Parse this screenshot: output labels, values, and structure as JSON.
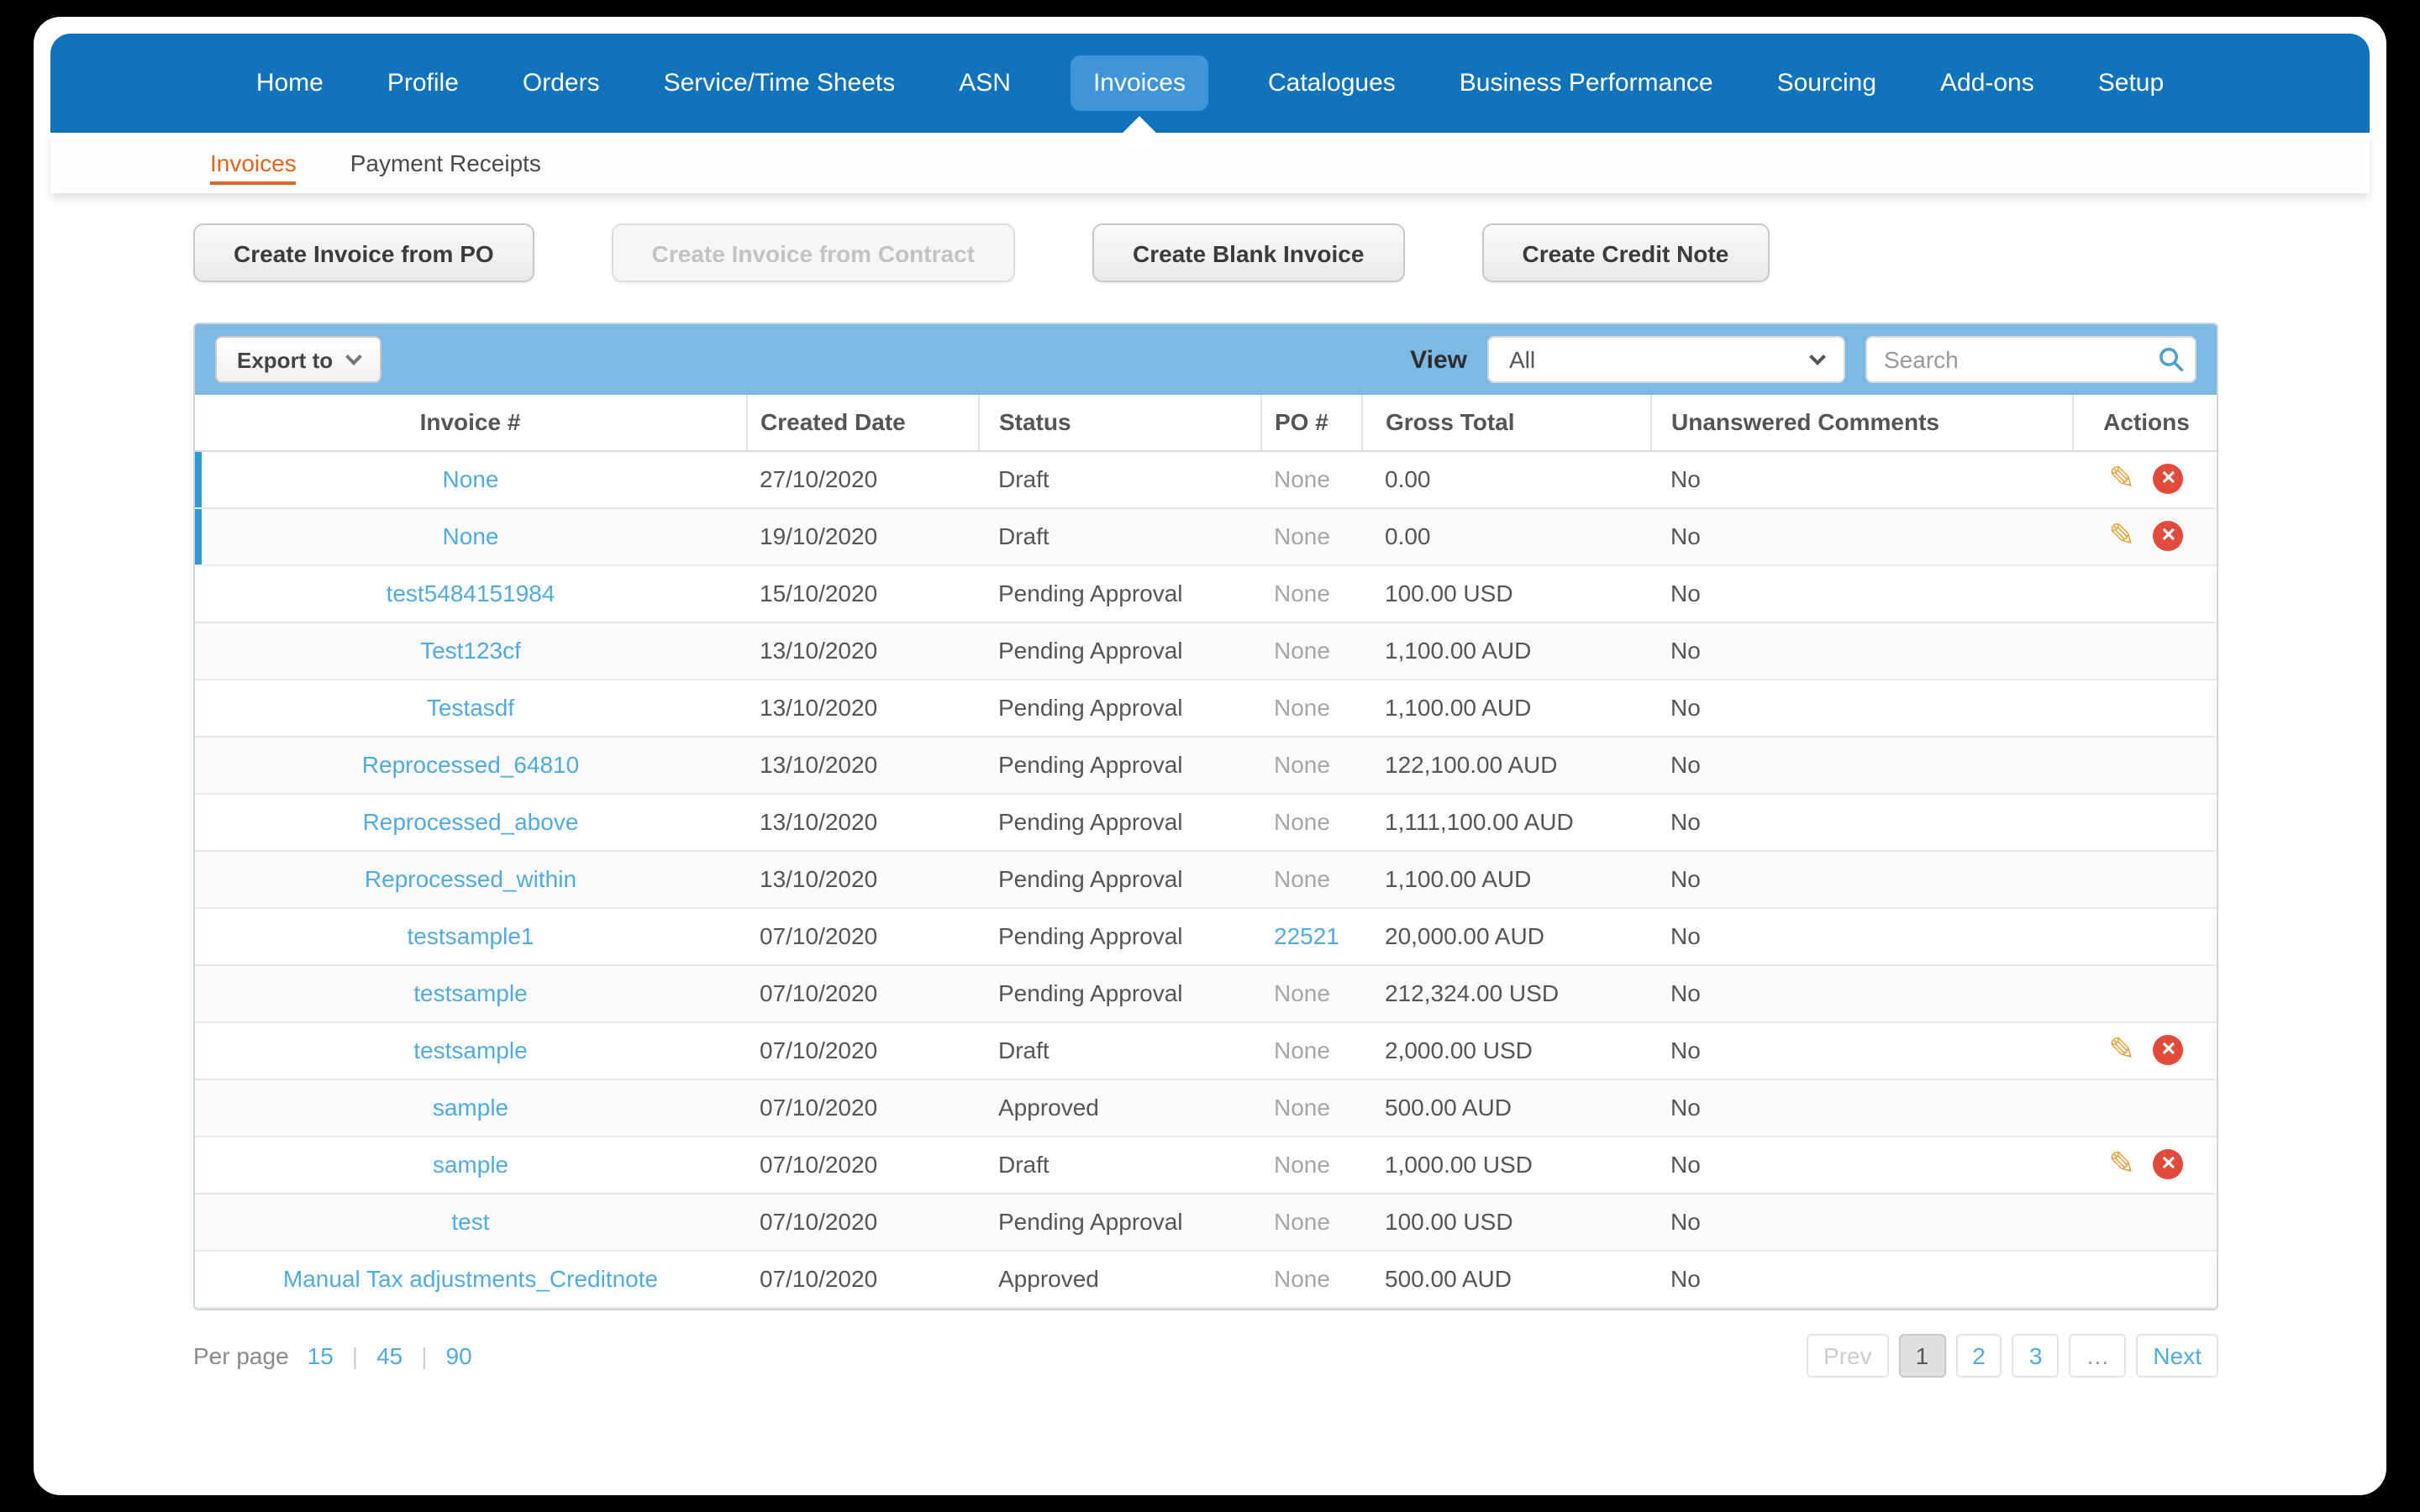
{
  "colors": {
    "nav_blue": "#1173BB",
    "active_tab_blue": "#3F95D8",
    "toolbar_blue": "#7DB9E3",
    "link_blue": "#52ABDF",
    "active_orange": "#E0651E",
    "delete_red": "#E14B3B",
    "pencil_orange": "#E5A33C"
  },
  "icons": {
    "edit_pencil": "✎",
    "delete_x": "✕"
  },
  "nav": {
    "items": [
      {
        "label": "Home",
        "active": false
      },
      {
        "label": "Profile",
        "active": false
      },
      {
        "label": "Orders",
        "active": false
      },
      {
        "label": "Service/Time Sheets",
        "active": false
      },
      {
        "label": "ASN",
        "active": false
      },
      {
        "label": "Invoices",
        "active": true
      },
      {
        "label": "Catalogues",
        "active": false
      },
      {
        "label": "Business Performance",
        "active": false
      },
      {
        "label": "Sourcing",
        "active": false
      },
      {
        "label": "Add-ons",
        "active": false
      },
      {
        "label": "Setup",
        "active": false
      }
    ]
  },
  "subnav": {
    "items": [
      {
        "label": "Invoices",
        "active": true
      },
      {
        "label": "Payment Receipts",
        "active": false
      }
    ]
  },
  "actions_bar": {
    "buttons": [
      {
        "label": "Create Invoice from PO",
        "enabled": true
      },
      {
        "label": "Create Invoice from Contract",
        "enabled": false
      },
      {
        "label": "Create Blank Invoice",
        "enabled": true
      },
      {
        "label": "Create Credit Note",
        "enabled": true
      }
    ]
  },
  "table_toolbar": {
    "export_label": "Export to",
    "view_label": "View",
    "view_value": "All",
    "search_placeholder": "Search"
  },
  "table": {
    "columns": [
      "Invoice #",
      "Created Date",
      "Status",
      "PO #",
      "Gross Total",
      "Unanswered Comments",
      "Actions"
    ],
    "rows": [
      {
        "invoice": "None",
        "created": "27/10/2020",
        "status": "Draft",
        "po": "None",
        "po_is_link": false,
        "gross": "0.00",
        "comments": "No",
        "has_actions": true,
        "selected": true
      },
      {
        "invoice": "None",
        "created": "19/10/2020",
        "status": "Draft",
        "po": "None",
        "po_is_link": false,
        "gross": "0.00",
        "comments": "No",
        "has_actions": true,
        "selected": true
      },
      {
        "invoice": "test5484151984",
        "created": "15/10/2020",
        "status": "Pending Approval",
        "po": "None",
        "po_is_link": false,
        "gross": "100.00 USD",
        "comments": "No",
        "has_actions": false,
        "selected": false
      },
      {
        "invoice": "Test123cf",
        "created": "13/10/2020",
        "status": "Pending Approval",
        "po": "None",
        "po_is_link": false,
        "gross": "1,100.00 AUD",
        "comments": "No",
        "has_actions": false,
        "selected": false
      },
      {
        "invoice": "Testasdf",
        "created": "13/10/2020",
        "status": "Pending Approval",
        "po": "None",
        "po_is_link": false,
        "gross": "1,100.00 AUD",
        "comments": "No",
        "has_actions": false,
        "selected": false
      },
      {
        "invoice": "Reprocessed_64810",
        "created": "13/10/2020",
        "status": "Pending Approval",
        "po": "None",
        "po_is_link": false,
        "gross": "122,100.00 AUD",
        "comments": "No",
        "has_actions": false,
        "selected": false
      },
      {
        "invoice": "Reprocessed_above",
        "created": "13/10/2020",
        "status": "Pending Approval",
        "po": "None",
        "po_is_link": false,
        "gross": "1,111,100.00 AUD",
        "comments": "No",
        "has_actions": false,
        "selected": false
      },
      {
        "invoice": "Reprocessed_within",
        "created": "13/10/2020",
        "status": "Pending Approval",
        "po": "None",
        "po_is_link": false,
        "gross": "1,100.00 AUD",
        "comments": "No",
        "has_actions": false,
        "selected": false
      },
      {
        "invoice": "testsample1",
        "created": "07/10/2020",
        "status": "Pending Approval",
        "po": "22521",
        "po_is_link": true,
        "gross": "20,000.00 AUD",
        "comments": "No",
        "has_actions": false,
        "selected": false
      },
      {
        "invoice": "testsample",
        "created": "07/10/2020",
        "status": "Pending Approval",
        "po": "None",
        "po_is_link": false,
        "gross": "212,324.00 USD",
        "comments": "No",
        "has_actions": false,
        "selected": false
      },
      {
        "invoice": "testsample",
        "created": "07/10/2020",
        "status": "Draft",
        "po": "None",
        "po_is_link": false,
        "gross": "2,000.00 USD",
        "comments": "No",
        "has_actions": true,
        "selected": false
      },
      {
        "invoice": "sample",
        "created": "07/10/2020",
        "status": "Approved",
        "po": "None",
        "po_is_link": false,
        "gross": "500.00 AUD",
        "comments": "No",
        "has_actions": false,
        "selected": false
      },
      {
        "invoice": "sample",
        "created": "07/10/2020",
        "status": "Draft",
        "po": "None",
        "po_is_link": false,
        "gross": "1,000.00 USD",
        "comments": "No",
        "has_actions": true,
        "selected": false
      },
      {
        "invoice": "test",
        "created": "07/10/2020",
        "status": "Pending Approval",
        "po": "None",
        "po_is_link": false,
        "gross": "100.00 USD",
        "comments": "No",
        "has_actions": false,
        "selected": false
      },
      {
        "invoice": "Manual Tax adjustments_Creditnote",
        "created": "07/10/2020",
        "status": "Approved",
        "po": "None",
        "po_is_link": false,
        "gross": "500.00 AUD",
        "comments": "No",
        "has_actions": false,
        "selected": false
      }
    ]
  },
  "footer": {
    "per_page_label": "Per page",
    "per_page_options": [
      "15",
      "45",
      "90"
    ],
    "pagination": {
      "items": [
        {
          "label": "Prev",
          "type": "disabled"
        },
        {
          "label": "1",
          "type": "current"
        },
        {
          "label": "2",
          "type": "link"
        },
        {
          "label": "3",
          "type": "link"
        },
        {
          "label": "…",
          "type": "ellipsis"
        },
        {
          "label": "Next",
          "type": "link"
        }
      ]
    }
  }
}
